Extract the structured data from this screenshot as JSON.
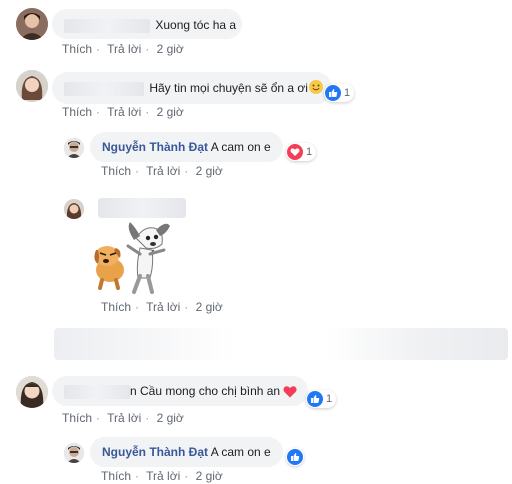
{
  "comments": [
    {
      "text": "Xuong tóc ha a",
      "actions": {
        "like": "Thích",
        "reply": "Trả lời",
        "sep": "·",
        "time": "2 giờ"
      }
    },
    {
      "text": "Hãy tin mọi chuyện sẽ ổn a ơi",
      "reaction_count": "1",
      "actions": {
        "like": "Thích",
        "reply": "Trả lời",
        "sep": "·",
        "time": "2 giờ"
      },
      "replies": [
        {
          "author": "Nguyễn Thành Đạt",
          "text": "A cam on e",
          "reaction_count": "1",
          "actions": {
            "like": "Thích",
            "reply": "Trả lời",
            "sep": "·",
            "time": "2 giờ"
          }
        },
        {
          "sticker": "dog-sticker",
          "actions": {
            "like": "Thích",
            "reply": "Trả lời",
            "sep": "·",
            "time": "2 giờ"
          }
        }
      ]
    },
    {
      "text": "n Cầu mong cho chị bình an",
      "reaction_count": "1",
      "actions": {
        "like": "Thích",
        "reply": "Trả lời",
        "sep": "·",
        "time": "2 giờ"
      },
      "replies": [
        {
          "author": "Nguyễn Thành Đạt",
          "text": "A cam on e",
          "actions": {
            "like": "Thích",
            "reply": "Trả lời",
            "sep": "·",
            "time": "2 giờ"
          }
        }
      ]
    }
  ],
  "colors": {
    "like": "#2078f4",
    "heart": "#f33e58",
    "name": "#385898",
    "bubble": "#f2f3f5"
  }
}
